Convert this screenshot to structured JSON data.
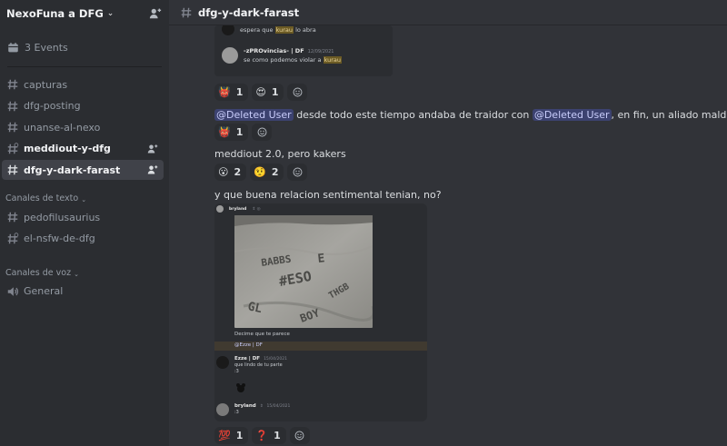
{
  "server": {
    "name": "NexoFuna a DFG"
  },
  "events": {
    "label": "3 Events"
  },
  "channels": [
    {
      "name": "capturas"
    },
    {
      "name": "dfg-posting"
    },
    {
      "name": "unanse-al-nexo"
    },
    {
      "name": "meddiout-y-dfg"
    },
    {
      "name": "dfg-y-dark-farast"
    }
  ],
  "categories": {
    "text": {
      "label": "Canales de texto",
      "channels": [
        {
          "name": "pedofilusaurius"
        },
        {
          "name": "el-nsfw-de-dfg"
        }
      ]
    },
    "voice": {
      "label": "Canales de voz",
      "channels": [
        {
          "name": "General"
        }
      ]
    }
  },
  "header": {
    "channel": "dfg-y-dark-farast"
  },
  "snippet1": {
    "line1": {
      "pre": "espera que ",
      "hl": "kurau",
      "post": " lo abra"
    },
    "msg2": {
      "author": "-zPROvincias- | DF",
      "time": "12/09/2021",
      "pre": "se como podemos violar a ",
      "hl": "kurau"
    }
  },
  "reactions": {
    "r1": [
      {
        "emoji": "👹",
        "count": "1"
      },
      {
        "emoji": "😍",
        "count": "1"
      }
    ],
    "r2": [
      {
        "emoji": "👹",
        "count": "1"
      }
    ],
    "r3": [
      {
        "emoji": "😮",
        "count": "2"
      },
      {
        "emoji": "🤨",
        "count": "2"
      }
    ],
    "r4": [
      {
        "emoji": "💯",
        "count": "1"
      },
      {
        "emoji": "❓",
        "count": "1"
      }
    ]
  },
  "messages": {
    "m1": {
      "mention1": "@Deleted User",
      "mid": " desde todo este tiempo andaba de traidor con ",
      "mention2": "@Deleted User",
      "end": ", en fin, un aliado maldawano"
    },
    "m2": {
      "text": "meddiout 2.0, pero kakers"
    },
    "m3": {
      "text": "y que buena relacion sentimental tenian, no?"
    }
  },
  "attachment": {
    "author": "bryland",
    "author_tag": "⇕ ◎",
    "photo_text": [
      "BABBS",
      "E",
      "#ESO",
      "GL",
      "THGB",
      "BOY"
    ],
    "caption": "Decime que te parece",
    "quote": "@Ezze | DF",
    "reply1": {
      "author": "Ezze | DF",
      "time": "15/04/2021",
      "lines": [
        "que lindo de tu parte",
        ":3"
      ]
    },
    "reply2": {
      "author": "bryland",
      "tag": "⇕",
      "time": "15/04/2021",
      "text": ":3"
    }
  },
  "colors": {
    "sidebar": "#2b2d31",
    "main": "#313338",
    "active": "#404249",
    "mention_bg": "#3c4270",
    "mention_fg": "#c9cdfb"
  }
}
